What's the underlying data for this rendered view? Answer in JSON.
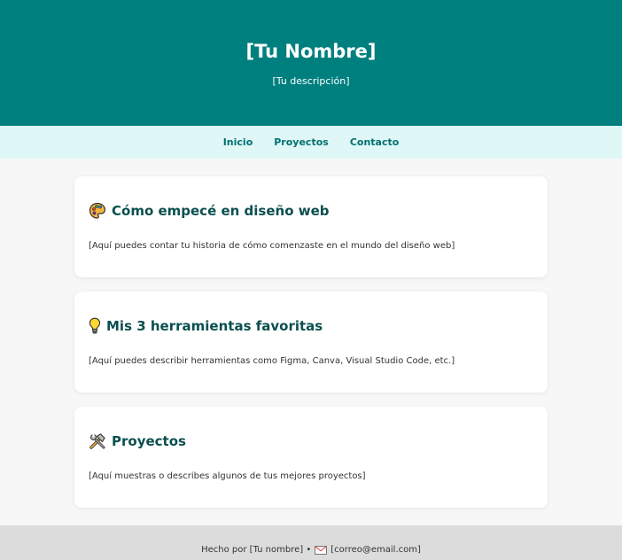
{
  "header": {
    "title": "[Tu Nombre]",
    "description": "[Tu descripción]",
    "background_color": "#007f7f"
  },
  "nav": {
    "items": [
      {
        "label": "Inicio"
      },
      {
        "label": "Proyectos"
      },
      {
        "label": "Contacto"
      }
    ],
    "background_color": "#e0f7f7",
    "link_color": "#007070"
  },
  "sections": [
    {
      "icon": "palette-icon",
      "title": "Cómo empecé en diseño web",
      "body": "[Aquí puedes contar tu historia de cómo comenzaste en el mundo del diseño web]"
    },
    {
      "icon": "lightbulb-icon",
      "title": "Mis 3 herramientas favoritas",
      "body": "[Aquí puedes describir herramientas como Figma, Canva, Visual Studio Code, etc.]"
    },
    {
      "icon": "hammer-wrench-icon",
      "title": "Proyectos",
      "body": "[Aquí muestras o describes algunos de tus mejores proyectos]"
    }
  ],
  "footer": {
    "prefix": "Hecho por [Tu nombre] •",
    "email_icon": "envelope-icon",
    "email": "[correo@email.com]"
  }
}
